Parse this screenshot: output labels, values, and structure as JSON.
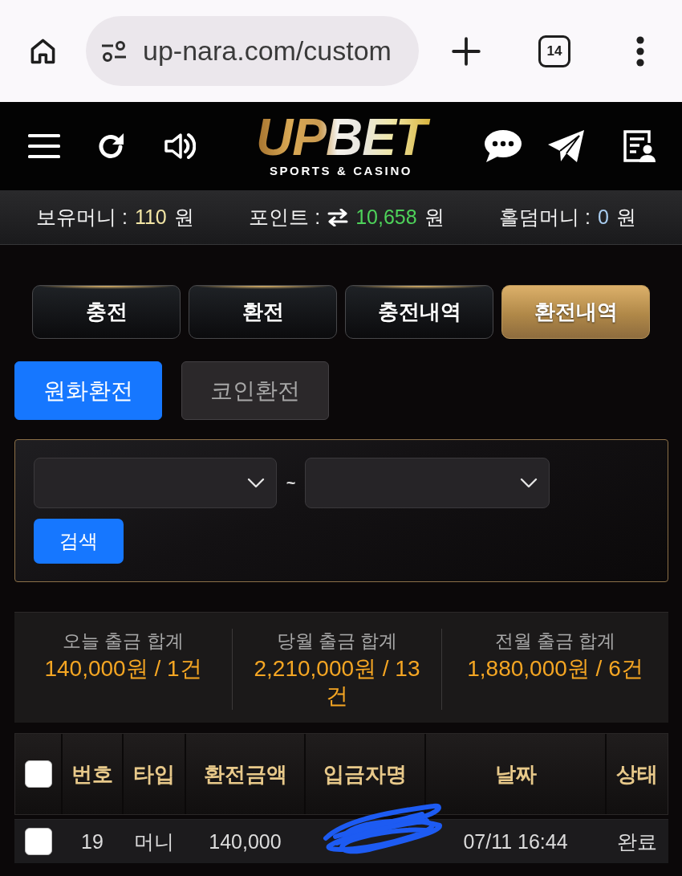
{
  "browser": {
    "url": "up-nara.com/custom",
    "tab_count": "14"
  },
  "header": {
    "logo": "UPBET",
    "tagline": "SPORTS & CASINO"
  },
  "balances": [
    {
      "kind": "plain",
      "label": "보유머니 :",
      "value": "110",
      "unit": "원",
      "color": "#f3e6a6"
    },
    {
      "kind": "swap",
      "label": "포인트 :",
      "value": "10,658",
      "unit": "원",
      "color": "#4ed25a"
    },
    {
      "kind": "plain",
      "label": "홀덤머니 :",
      "value": "0",
      "unit": "원",
      "color": "#a9cdf0"
    }
  ],
  "tabs": [
    {
      "label": "충전",
      "selected": false
    },
    {
      "label": "환전",
      "selected": false
    },
    {
      "label": "충전내역",
      "selected": false
    },
    {
      "label": "환전내역",
      "selected": true
    }
  ],
  "subtabs": [
    {
      "label": "원화환전",
      "selected": true
    },
    {
      "label": "코인환전",
      "selected": false
    }
  ],
  "filter": {
    "separator": "~",
    "search_button": "검색"
  },
  "summary": [
    {
      "label": "오늘 출금 합계",
      "value": "140,000원 / 1건"
    },
    {
      "label": "당월 출금 합계",
      "value": "2,210,000원 / 13건"
    },
    {
      "label": "전월 출금 합계",
      "value": "1,880,000원 / 6건"
    }
  ],
  "table": {
    "select_all_checked": false,
    "columns": [
      "번호",
      "타입",
      "환전금액",
      "입금자명",
      "날짜",
      "상태"
    ],
    "rows": [
      {
        "checked": false,
        "number": "19",
        "type": "머니",
        "amount": "140,000",
        "depositor_redacted": true,
        "date": "07/11 16:44",
        "status": "완료"
      }
    ]
  }
}
